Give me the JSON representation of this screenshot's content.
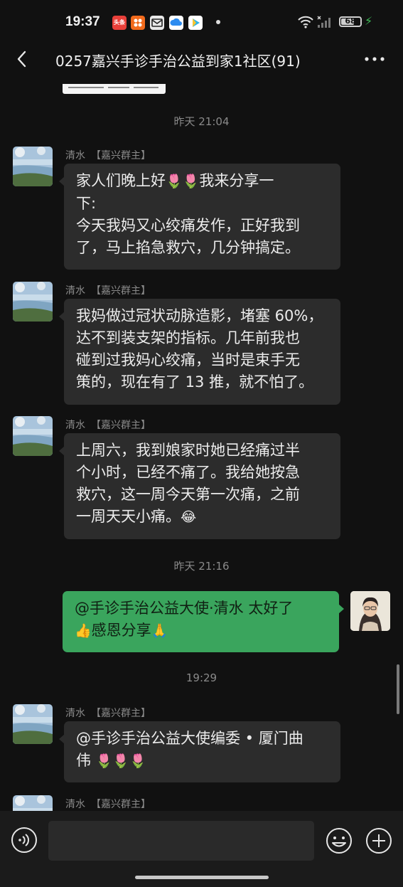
{
  "status_bar": {
    "time": "19:37",
    "app_icons": [
      {
        "name": "toutiao-icon",
        "label": "头条",
        "color": "#e8403a"
      },
      {
        "name": "app-grid-icon",
        "label": "",
        "color": "#f26b1d"
      },
      {
        "name": "mail-icon",
        "label": "",
        "color": "#e8e8e8"
      },
      {
        "name": "cloud-app-icon",
        "label": "",
        "color": "#2d8cf0"
      },
      {
        "name": "play-app-icon",
        "label": "",
        "color": "#2fb3e8"
      }
    ],
    "battery_level": 68,
    "battery_text": "68",
    "charging": true
  },
  "header": {
    "title": "0257嘉兴手诊手治公益到家1社区(91)",
    "back_icon": "chevron-left-icon",
    "more_icon": "more-dots-icon"
  },
  "messages": {
    "time1": "昨天 21:04",
    "m1": {
      "name": "清水",
      "role": "【嘉兴群主】",
      "l1": "家人们晚上好",
      "l1b": "我来分享一",
      "l2": "下:",
      "l3": "今天我妈又心绞痛发作，正好我到",
      "l4": "了，马上掐急救穴，几分钟搞定。"
    },
    "m2": {
      "name": "清水",
      "role": "【嘉兴群主】",
      "l1": "我妈做过冠状动脉造影，堵塞 60%，",
      "l2": "达不到装支架的指标。几年前我也",
      "l3": "碰到过我妈心绞痛，当时是束手无",
      "l4": "策的，现在有了 13 推，就不怕了。"
    },
    "m3": {
      "name": "清水",
      "role": "【嘉兴群主】",
      "l1": "上周六，我到娘家时她已经痛过半",
      "l2": "个小时，已经不痛了。我给她按急",
      "l3": "救穴，这一周今天第一次痛，之前",
      "l4": "一周天天小痛。"
    },
    "time2": "昨天 21:16",
    "m4": {
      "l1": "@手诊手治公益大使·清水  太好了",
      "l2": "感恩分享"
    },
    "time3": "19:29",
    "m5": {
      "name": "清水",
      "role": "【嘉兴群主】",
      "l1": "@手诊手治公益大使编委 • 厦门曲",
      "l2": "伟"
    },
    "m6": {
      "name": "清水",
      "role": "【嘉兴群主】"
    }
  },
  "emoji": {
    "tulip": "🌷",
    "laugh_cry": "😂",
    "thumbs_up": "👍",
    "pray": "🙏"
  },
  "colors": {
    "background": "#111111",
    "bubble_other": "#2c2c2c",
    "bubble_self": "#3aa55d"
  }
}
